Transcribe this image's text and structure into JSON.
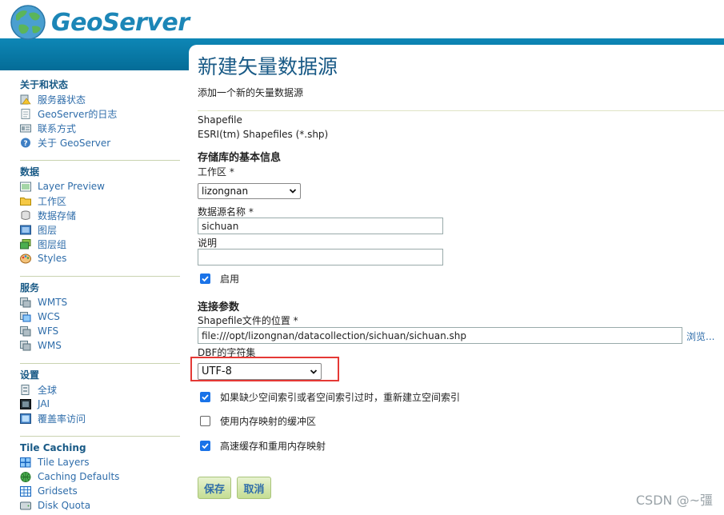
{
  "header": {
    "logo_text": "GeoServer"
  },
  "sidebar": {
    "sections": [
      {
        "title": "关于和状态",
        "items": [
          "服务器状态",
          "GeoServer的日志",
          "联系方式",
          "关于 GeoServer"
        ]
      },
      {
        "title": "数据",
        "items": [
          "Layer Preview",
          "工作区",
          "数据存储",
          "图层",
          "图层组",
          "Styles"
        ]
      },
      {
        "title": "服务",
        "items": [
          "WMTS",
          "WCS",
          "WFS",
          "WMS"
        ]
      },
      {
        "title": "设置",
        "items": [
          "全球",
          "JAI",
          "覆盖率访问"
        ]
      },
      {
        "title": "Tile Caching",
        "items": [
          "Tile Layers",
          "Caching Defaults",
          "Gridsets",
          "Disk Quota"
        ]
      }
    ]
  },
  "main": {
    "title": "新建矢量数据源",
    "description": "添加一个新的矢量数据源",
    "store_type": "Shapefile",
    "store_type_desc": "ESRI(tm) Shapefiles (*.shp)",
    "basic_info_title": "存储库的基本信息",
    "workspace_label": "工作区 *",
    "workspace_value": "lizongnan",
    "datasource_label": "数据源名称 *",
    "datasource_value": "sichuan",
    "description_label": "说明",
    "description_value": "",
    "enabled_label": "启用",
    "enabled": true,
    "connection_title": "连接参数",
    "shapefile_label": "Shapefile文件的位置 *",
    "shapefile_value": "file:///opt/lizongnan/datacollection/sichuan/sichuan.shp",
    "browse_label": "浏览...",
    "charset_label": "DBF的字符集",
    "charset_value": "UTF-8",
    "option1_label": "如果缺少空间索引或者空间索引过时，重新建立空间索引",
    "option1": true,
    "option2_label": "使用内存映射的缓冲区",
    "option2": false,
    "option3_label": "高速缓存和重用内存映射",
    "option3": true,
    "save_label": "保存",
    "cancel_label": "取消"
  },
  "watermark": "CSDN @~彊",
  "colors": {
    "accent_blue": "#1c86b7",
    "header_band": "#0e87b6",
    "highlight": "#e53935",
    "checkbox": "#1a73e8"
  }
}
